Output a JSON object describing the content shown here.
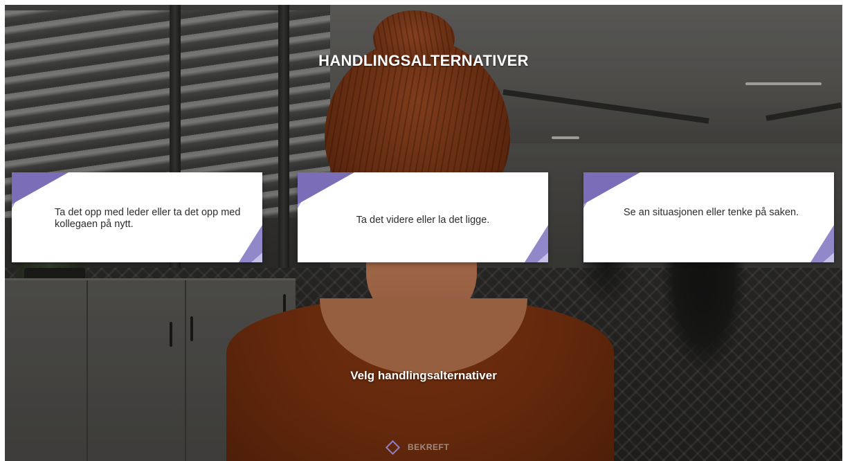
{
  "title": "HANDLINGSALTERNATIVER",
  "options": [
    {
      "text": "Ta det opp med leder eller ta det opp med kollegaen på nytt."
    },
    {
      "text": "Ta det videre eller la det ligge."
    },
    {
      "text": "Se an situasjonen eller tenke på saken."
    }
  ],
  "prompt": "Velg handlingsalternativer",
  "confirm": {
    "label": "BEKREFT",
    "icon": "diamond-icon"
  },
  "colors": {
    "accent": "#7b6db7",
    "accent_light": "#a79fd6",
    "card_bg": "#ffffff",
    "title_text": "#ffffff"
  }
}
